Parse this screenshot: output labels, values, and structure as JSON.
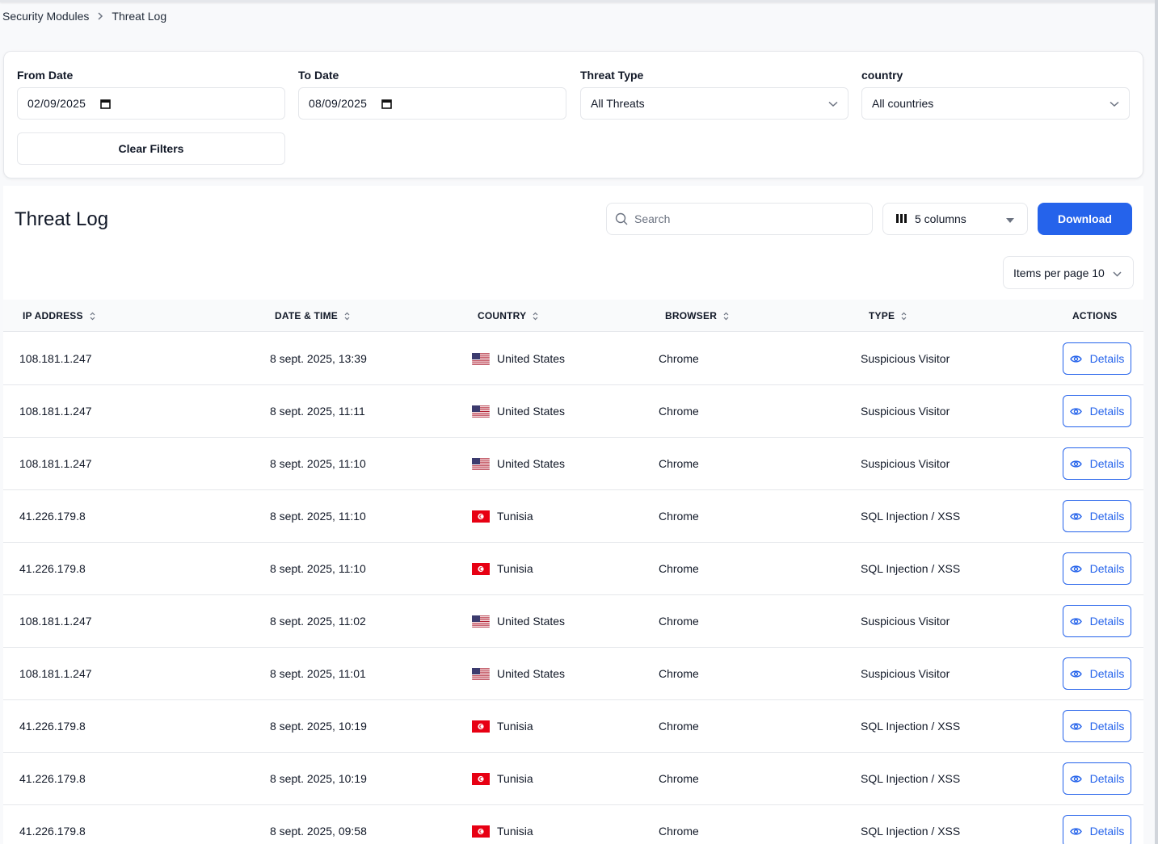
{
  "breadcrumb": {
    "parent": "Security Modules",
    "current": "Threat Log"
  },
  "filters": {
    "from_label": "From Date",
    "from_value": "02/09/2025",
    "to_label": "To Date",
    "to_value": "08/09/2025",
    "type_label": "Threat Type",
    "type_value": "All Threats",
    "country_label": "country",
    "country_value": "All countries",
    "clear_label": "Clear Filters"
  },
  "toolbar": {
    "title": "Threat Log",
    "search_placeholder": "Search",
    "columns_label": "5 columns",
    "download_label": "Download",
    "items_per_page": "Items per page 10"
  },
  "table": {
    "headers": [
      "IP ADDRESS",
      "DATE & TIME",
      "COUNTRY",
      "BROWSER",
      "TYPE",
      "ACTIONS"
    ],
    "action_label": "Details",
    "rows": [
      {
        "ip": "108.181.1.247",
        "datetime": "8 sept. 2025, 13:39",
        "country": "United States",
        "flag": "us-flag-icon",
        "browser": "Chrome",
        "type": "Suspicious Visitor"
      },
      {
        "ip": "108.181.1.247",
        "datetime": "8 sept. 2025, 11:11",
        "country": "United States",
        "flag": "us-flag-icon",
        "browser": "Chrome",
        "type": "Suspicious Visitor"
      },
      {
        "ip": "108.181.1.247",
        "datetime": "8 sept. 2025, 11:10",
        "country": "United States",
        "flag": "us-flag-icon",
        "browser": "Chrome",
        "type": "Suspicious Visitor"
      },
      {
        "ip": "41.226.179.8",
        "datetime": "8 sept. 2025, 11:10",
        "country": "Tunisia",
        "flag": "tn-flag-icon",
        "browser": "Chrome",
        "type": "SQL Injection / XSS"
      },
      {
        "ip": "41.226.179.8",
        "datetime": "8 sept. 2025, 11:10",
        "country": "Tunisia",
        "flag": "tn-flag-icon",
        "browser": "Chrome",
        "type": "SQL Injection / XSS"
      },
      {
        "ip": "108.181.1.247",
        "datetime": "8 sept. 2025, 11:02",
        "country": "United States",
        "flag": "us-flag-icon",
        "browser": "Chrome",
        "type": "Suspicious Visitor"
      },
      {
        "ip": "108.181.1.247",
        "datetime": "8 sept. 2025, 11:01",
        "country": "United States",
        "flag": "us-flag-icon",
        "browser": "Chrome",
        "type": "Suspicious Visitor"
      },
      {
        "ip": "41.226.179.8",
        "datetime": "8 sept. 2025, 10:19",
        "country": "Tunisia",
        "flag": "tn-flag-icon",
        "browser": "Chrome",
        "type": "SQL Injection / XSS"
      },
      {
        "ip": "41.226.179.8",
        "datetime": "8 sept. 2025, 10:19",
        "country": "Tunisia",
        "flag": "tn-flag-icon",
        "browser": "Chrome",
        "type": "SQL Injection / XSS"
      },
      {
        "ip": "41.226.179.8",
        "datetime": "8 sept. 2025, 09:58",
        "country": "Tunisia",
        "flag": "tn-flag-icon",
        "browser": "Chrome",
        "type": "SQL Injection / XSS"
      }
    ]
  },
  "colors": {
    "accent": "#2563eb",
    "border": "#e5e7eb",
    "header_bg": "#f9fafb"
  }
}
